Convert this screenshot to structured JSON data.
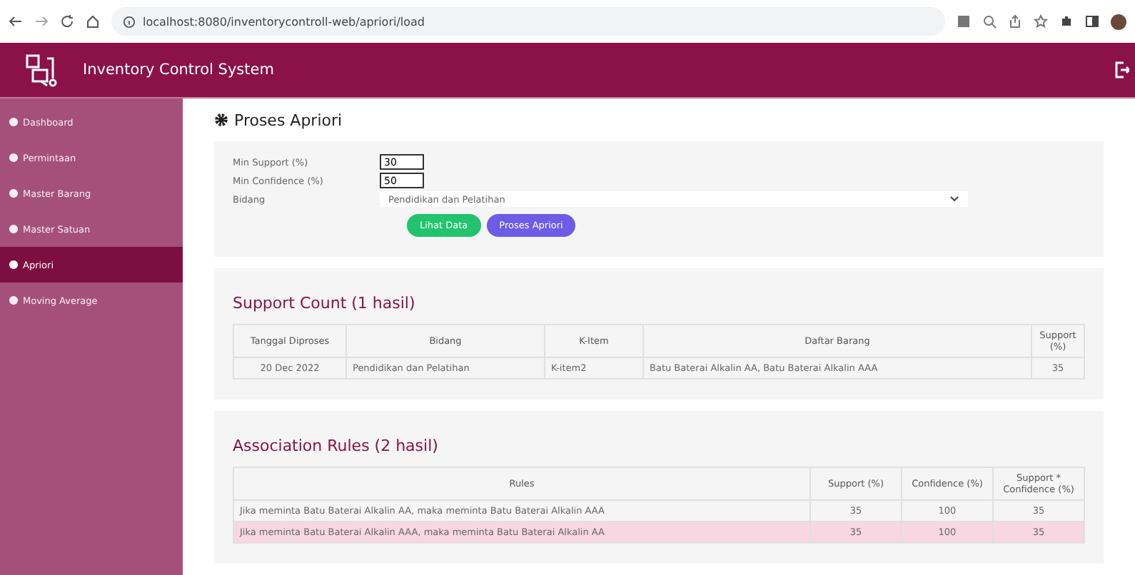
{
  "browser": {
    "url": "localhost:8080/inventorycontroll-web/apriori/load"
  },
  "header": {
    "title": "Inventory Control System"
  },
  "sidebar": {
    "items": [
      {
        "label": "Dashboard",
        "selected": false
      },
      {
        "label": "Permintaan",
        "selected": false
      },
      {
        "label": "Master Barang",
        "selected": false
      },
      {
        "label": "Master Satuan",
        "selected": false
      },
      {
        "label": "Apriori",
        "selected": true
      },
      {
        "label": "Moving Average",
        "selected": false
      }
    ]
  },
  "page_title": "Proses Apriori",
  "form": {
    "fields": [
      {
        "kind": "input",
        "label": "Min Support (%)",
        "value": "30"
      },
      {
        "kind": "input",
        "label": "Min Confidence (%)",
        "value": "50"
      },
      {
        "kind": "select",
        "label": "Bidang",
        "value": "Pendidikan dan Pelatihan"
      }
    ],
    "buttons": [
      {
        "label": "Lihat Data",
        "kind": "green"
      },
      {
        "label": "Proses Apriori",
        "kind": "purple"
      }
    ]
  },
  "support_count": {
    "title": "Support Count (1 hasil)",
    "columns": [
      "Tanggal Diproses",
      "Bidang",
      "K-Item",
      "Daftar Barang",
      "Support (%)"
    ],
    "rows": [
      {
        "cells": [
          "20 Dec 2022",
          "Pendidikan dan Pelatihan",
          "K-item2",
          "Batu Baterai Alkalin AA, Batu Baterai Alkalin AAA",
          "35"
        ]
      }
    ]
  },
  "association_rules": {
    "title": "Association Rules (2 hasil)",
    "columns": [
      "Rules",
      "Support (%)",
      "Confidence (%)",
      "Support * Confidence (%)"
    ],
    "rows": [
      {
        "highlighted": false,
        "cells": [
          "Jika meminta Batu Baterai Alkalin AA, maka meminta Batu Baterai Alkalin AAA",
          "35",
          "100",
          "35"
        ]
      },
      {
        "highlighted": true,
        "cells": [
          "Jika meminta Batu Baterai Alkalin AAA, maka meminta Batu Baterai Alkalin AA",
          "35",
          "100",
          "35"
        ]
      }
    ]
  }
}
